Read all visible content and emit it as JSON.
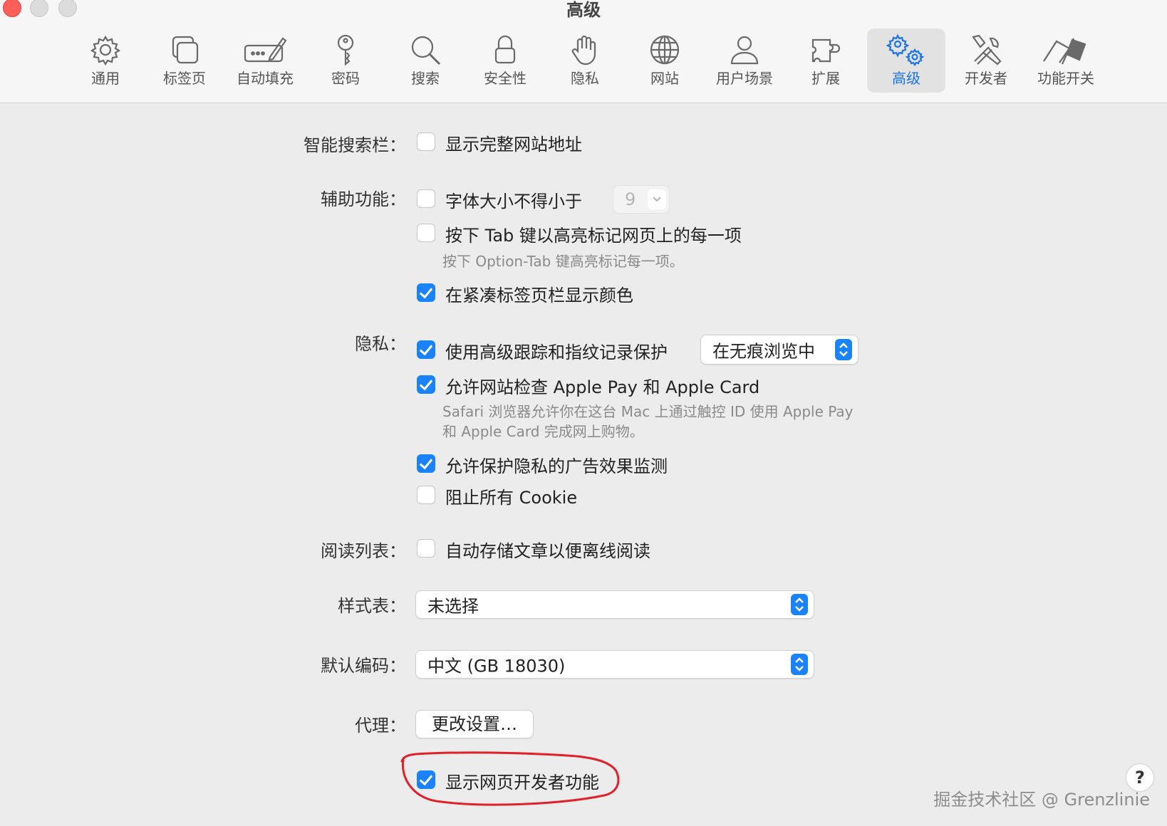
{
  "window": {
    "title": "高级"
  },
  "tabs": [
    {
      "id": "general",
      "label": "通用",
      "icon": "gear-icon"
    },
    {
      "id": "tabs",
      "label": "标签页",
      "icon": "tabs-icon"
    },
    {
      "id": "autofill",
      "label": "自动填充",
      "icon": "pen-field-icon"
    },
    {
      "id": "passwords",
      "label": "密码",
      "icon": "key-icon"
    },
    {
      "id": "search",
      "label": "搜索",
      "icon": "search-icon"
    },
    {
      "id": "security",
      "label": "安全性",
      "icon": "lock-icon"
    },
    {
      "id": "privacy",
      "label": "隐私",
      "icon": "hand-icon"
    },
    {
      "id": "websites",
      "label": "网站",
      "icon": "globe-icon"
    },
    {
      "id": "profiles",
      "label": "用户场景",
      "icon": "person-icon"
    },
    {
      "id": "extensions",
      "label": "扩展",
      "icon": "puzzle-icon"
    },
    {
      "id": "advanced",
      "label": "高级",
      "icon": "gears-icon",
      "active": true
    },
    {
      "id": "developer",
      "label": "开发者",
      "icon": "tools-icon"
    },
    {
      "id": "featureflags",
      "label": "功能开关",
      "icon": "flags-icon"
    }
  ],
  "sections": {
    "smart_search": {
      "label": "智能搜索栏：",
      "show_full_address": {
        "label": "显示完整网站地址",
        "checked": false
      }
    },
    "accessibility": {
      "label": "辅助功能：",
      "min_font_size": {
        "label": "字体大小不得小于",
        "checked": false,
        "value": "9"
      },
      "tab_highlight": {
        "label": "按下 Tab 键以高亮标记网页上的每一项",
        "checked": false
      },
      "tab_highlight_help": "按下 Option-Tab 键高亮标记每一项。",
      "compact_tab_color": {
        "label": "在紧凑标签页栏显示颜色",
        "checked": true
      }
    },
    "privacy": {
      "label": "隐私：",
      "tracking_protection": {
        "label": "使用高级跟踪和指纹记录保护",
        "checked": true,
        "mode": "在无痕浏览中"
      },
      "apple_pay": {
        "label": "允许网站检查 Apple Pay 和 Apple Card",
        "checked": true
      },
      "apple_pay_help_1": "Safari 浏览器允许你在这台 Mac 上通过触控 ID 使用 Apple Pay",
      "apple_pay_help_2": "和 Apple Card 完成网上购物。",
      "ad_measurement": {
        "label": "允许保护隐私的广告效果监测",
        "checked": true
      },
      "block_cookies": {
        "label": "阻止所有 Cookie",
        "checked": false
      }
    },
    "reading_list": {
      "label": "阅读列表：",
      "offline": {
        "label": "自动存储文章以便离线阅读",
        "checked": false
      }
    },
    "stylesheet": {
      "label": "样式表：",
      "value": "未选择"
    },
    "encoding": {
      "label": "默认编码：",
      "value": "中文 (GB 18030)"
    },
    "proxy": {
      "label": "代理：",
      "button": "更改设置…"
    },
    "developer": {
      "show_dev_features": {
        "label": "显示网页开发者功能",
        "checked": true
      }
    }
  },
  "help_button": "?",
  "watermark": "掘金技术社区 @ Grenzlinie",
  "colors": {
    "accent": "#1a82fb",
    "annotation": "#e0202a"
  }
}
